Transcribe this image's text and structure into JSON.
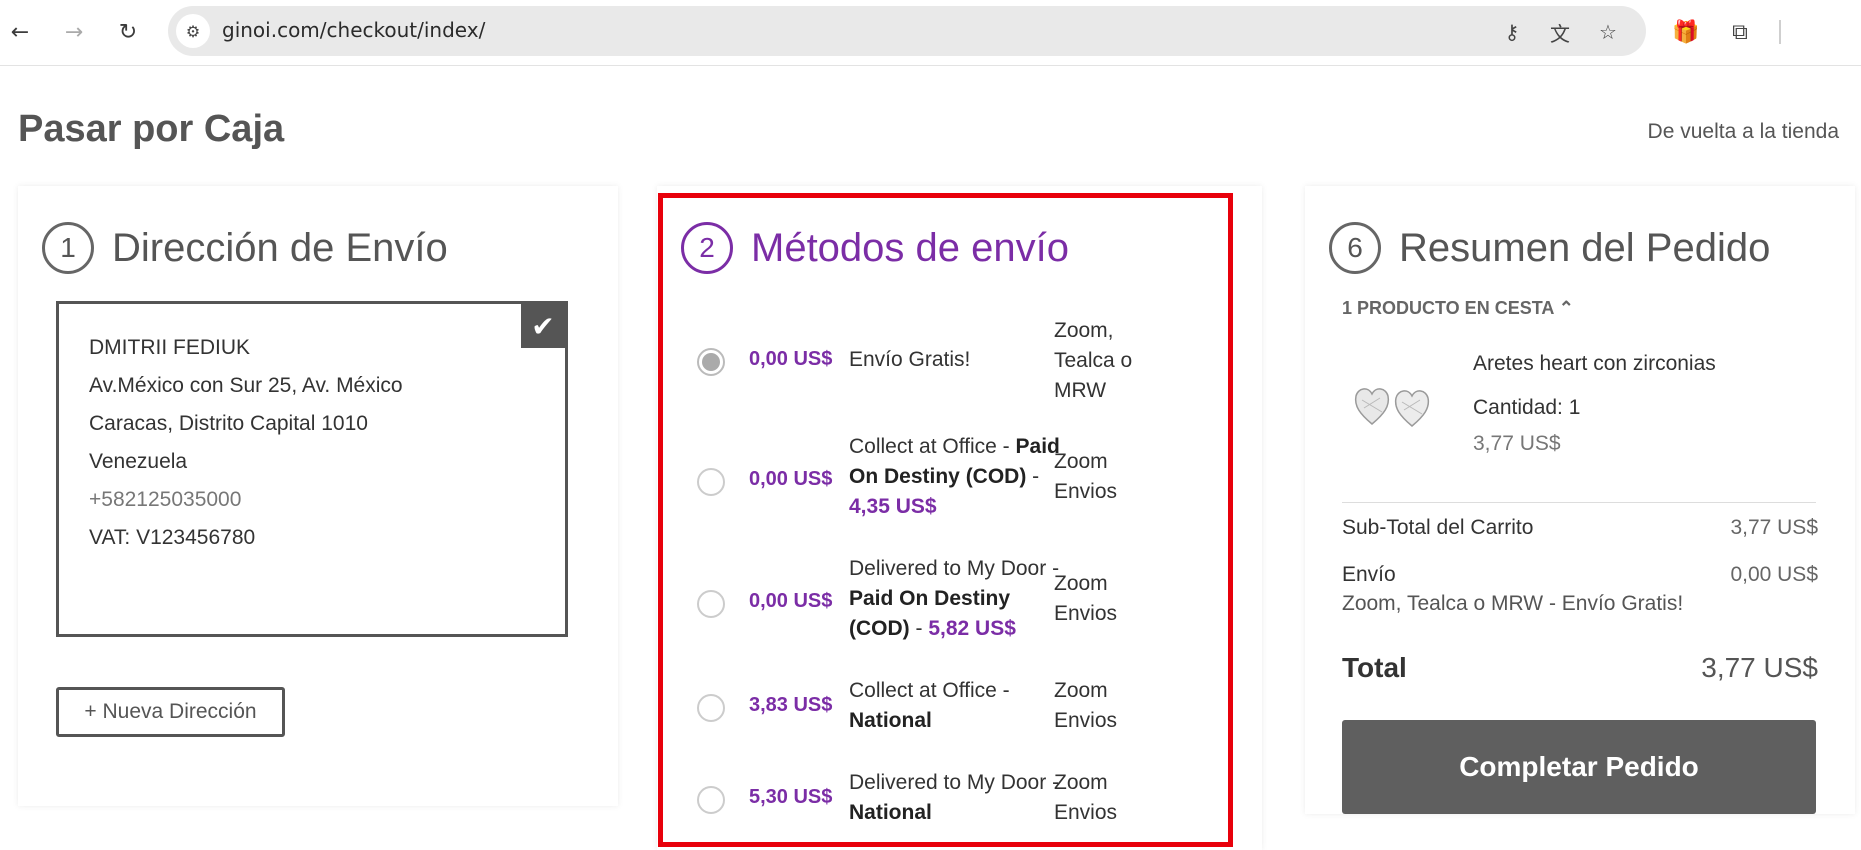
{
  "browser": {
    "url": "ginoi.com/checkout/index/"
  },
  "page": {
    "title": "Pasar por Caja",
    "back_link": "De vuelta a la tienda"
  },
  "shipping_address": {
    "step_number": "1",
    "heading": "Dirección de Envío",
    "name": "DMITRII FEDIUK",
    "street": "Av.México con Sur 25, Av. México",
    "city_line": "Caracas, Distrito Capital 1010",
    "country": "Venezuela",
    "phone": "+582125035000",
    "vat": "VAT: V123456780",
    "new_address_label": "+ Nueva Dirección"
  },
  "shipping_methods": {
    "step_number": "2",
    "heading": "Métodos de envío",
    "items": [
      {
        "price": "0,00 US$",
        "desc_plain": "Envío Gratis!",
        "desc_bold": "",
        "desc_extra": "",
        "carrier": "Zoom, Tealca o MRW",
        "selected": true
      },
      {
        "price": "0,00 US$",
        "desc_plain": "Collect at Office - ",
        "desc_bold": "Paid On Destiny (COD)",
        "desc_sep": " - ",
        "desc_extra": "4,35 US$",
        "carrier": "Zoom Envios",
        "selected": false
      },
      {
        "price": "0,00 US$",
        "desc_plain": "Delivered to My Door - ",
        "desc_bold": "Paid On Destiny (COD)",
        "desc_sep": " - ",
        "desc_extra": "5,82 US$",
        "carrier": "Zoom Envios",
        "selected": false
      },
      {
        "price": "3,83 US$",
        "desc_plain": "Collect at Office - ",
        "desc_bold": "National",
        "desc_extra": "",
        "carrier": "Zoom Envios",
        "selected": false
      },
      {
        "price": "5,30 US$",
        "desc_plain": "Delivered to My Door - ",
        "desc_bold": "National",
        "desc_extra": "",
        "carrier": "Zoom Envios",
        "selected": false
      }
    ]
  },
  "summary": {
    "step_number": "6",
    "heading": "Resumen del Pedido",
    "basket_toggle": "1 PRODUCTO EN CESTA",
    "product_name": "Aretes heart con zirconias",
    "product_qty": "Cantidad: 1",
    "product_price": "3,77 US$",
    "subtotal_label": "Sub-Total del Carrito",
    "subtotal_value": "3,77 US$",
    "shipping_label": "Envío",
    "shipping_value": "0,00 US$",
    "shipping_method_text": "Zoom, Tealca o MRW - Envío Gratis!",
    "total_label": "Total",
    "total_value": "3,77 US$",
    "complete_button": "Completar Pedido"
  },
  "colors": {
    "accent": "#7b2da6",
    "highlight": "#e8000b",
    "button": "#5f5f5f"
  }
}
